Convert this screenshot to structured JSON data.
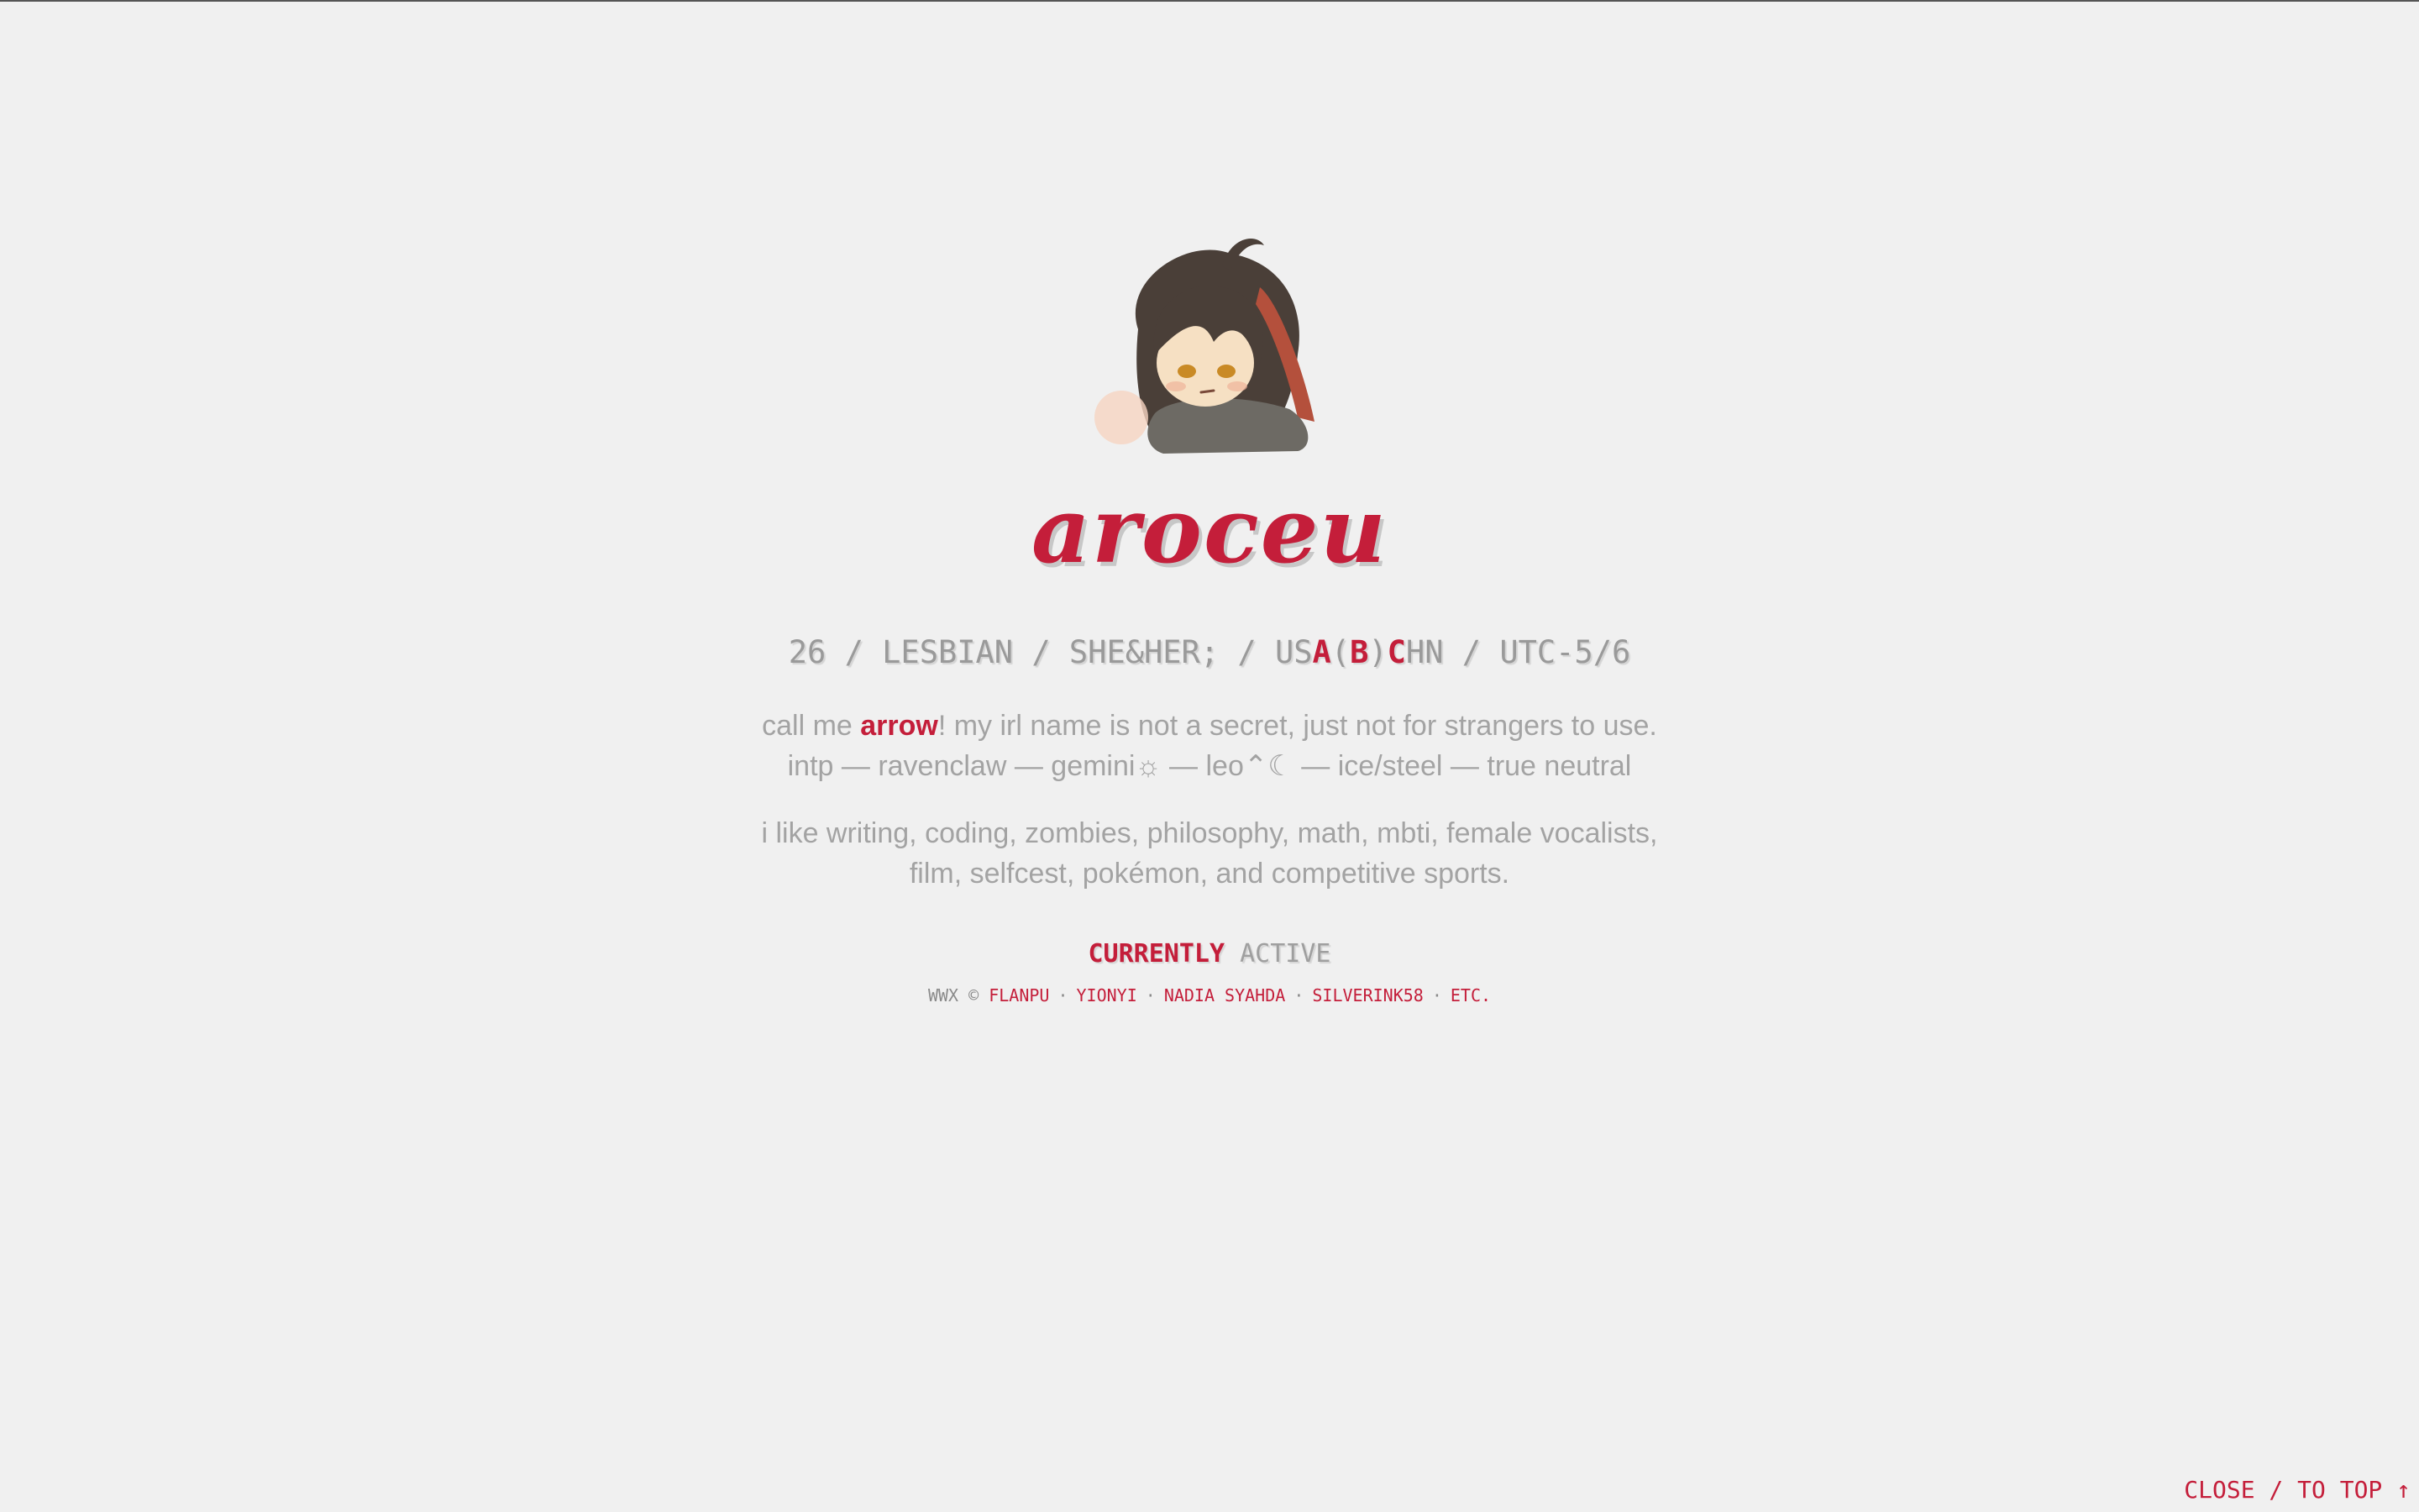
{
  "profile": {
    "username": "aroceu",
    "stats": {
      "age": "26",
      "orientation": "LESBIAN",
      "pronouns": "SHE&HER;",
      "location_prefix": "US",
      "loc_a": "A",
      "loc_paren_open": "(",
      "loc_b": "B",
      "loc_paren_close": ")",
      "loc_c": "C",
      "location_suffix": "HN",
      "timezone": "UTC-5/6",
      "separator": " / "
    },
    "bio": {
      "line1_pre": "call me ",
      "nickname": "arrow",
      "line1_post": "! my irl name is not a secret, just not for strangers to use.",
      "line2_a": "intp — ravenclaw — gemini",
      "sun_symbol": "☼",
      "line2_b": " — leo",
      "rising_symbol": "⌃",
      "moon_symbol": "☾",
      "line2_c": " — ice/steel — true neutral",
      "interests_line1": "i like writing, coding, zombies, philosophy, math, mbti, female vocalists,",
      "interests_line2": "film, selfcest, pokémon, and competitive sports."
    },
    "status": {
      "label": "CURRENTLY",
      "value": "ACTIVE"
    },
    "credits": {
      "prefix": "WWX © ",
      "links": [
        "FLANPU",
        "YIONYI",
        "NADIA SYAHDA",
        "SILVERINK58",
        "ETC."
      ],
      "separator": "·"
    }
  },
  "footer": {
    "close_label": "CLOSE / TO TOP ↑"
  },
  "colors": {
    "accent": "#c41e3a",
    "text_muted": "#9a9a9a",
    "background": "#f0f0f0"
  },
  "icons": {
    "avatar": "chibi-character-avatar",
    "sun": "sun-icon",
    "rising": "rising-icon",
    "moon": "moon-icon"
  }
}
